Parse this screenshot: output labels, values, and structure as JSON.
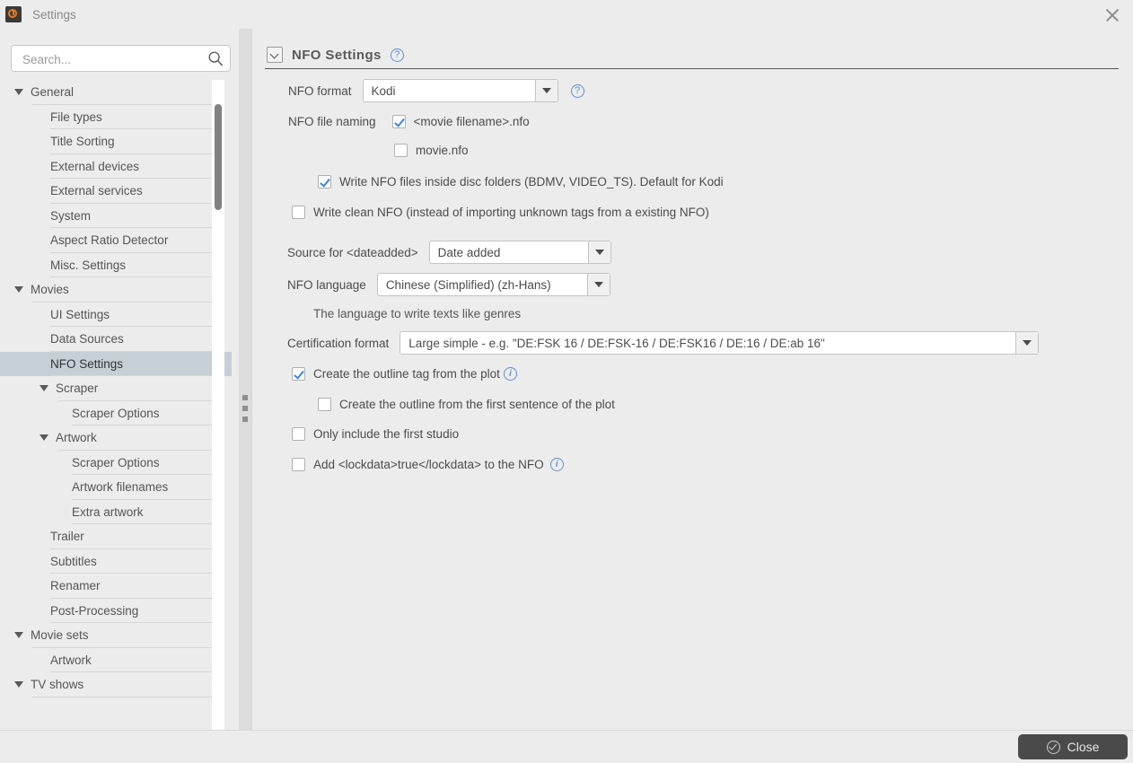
{
  "window": {
    "title": "Settings",
    "app_icon": "tinymediamanager-logo-icon",
    "close_icon": "close-icon"
  },
  "search": {
    "placeholder": "Search...",
    "value": "",
    "icon": "search-icon"
  },
  "sidebar": {
    "items": [
      {
        "label": "General",
        "level": 0,
        "expandable": true,
        "selected": false
      },
      {
        "label": "File types",
        "level": 1,
        "expandable": false,
        "selected": false
      },
      {
        "label": "Title Sorting",
        "level": 1,
        "expandable": false,
        "selected": false
      },
      {
        "label": "External devices",
        "level": 1,
        "expandable": false,
        "selected": false
      },
      {
        "label": "External services",
        "level": 1,
        "expandable": false,
        "selected": false
      },
      {
        "label": "System",
        "level": 1,
        "expandable": false,
        "selected": false
      },
      {
        "label": "Aspect Ratio Detector",
        "level": 1,
        "expandable": false,
        "selected": false
      },
      {
        "label": "Misc. Settings",
        "level": 1,
        "expandable": false,
        "selected": false
      },
      {
        "label": "Movies",
        "level": 0,
        "expandable": true,
        "selected": false
      },
      {
        "label": "UI Settings",
        "level": 1,
        "expandable": false,
        "selected": false
      },
      {
        "label": "Data Sources",
        "level": 1,
        "expandable": false,
        "selected": false
      },
      {
        "label": "NFO Settings",
        "level": 1,
        "expandable": false,
        "selected": true
      },
      {
        "label": "Scraper",
        "level": 2,
        "expandable": true,
        "selected": false
      },
      {
        "label": "Scraper Options",
        "level": 3,
        "expandable": false,
        "selected": false
      },
      {
        "label": "Artwork",
        "level": 2,
        "expandable": true,
        "selected": false
      },
      {
        "label": "Scraper Options",
        "level": 3,
        "expandable": false,
        "selected": false
      },
      {
        "label": "Artwork filenames",
        "level": 3,
        "expandable": false,
        "selected": false
      },
      {
        "label": "Extra artwork",
        "level": 3,
        "expandable": false,
        "selected": false
      },
      {
        "label": "Trailer",
        "level": 1,
        "expandable": false,
        "selected": false
      },
      {
        "label": "Subtitles",
        "level": 1,
        "expandable": false,
        "selected": false
      },
      {
        "label": "Renamer",
        "level": 1,
        "expandable": false,
        "selected": false
      },
      {
        "label": "Post-Processing",
        "level": 1,
        "expandable": false,
        "selected": false
      },
      {
        "label": "Movie sets",
        "level": 0,
        "expandable": true,
        "selected": false
      },
      {
        "label": "Artwork",
        "level": 1,
        "expandable": false,
        "selected": false
      },
      {
        "label": "TV shows",
        "level": 0,
        "expandable": true,
        "selected": false
      }
    ]
  },
  "panel": {
    "title": "NFO Settings",
    "collapse_icon": "chevron-down-box-icon",
    "help_icon": "help-icon",
    "nfo_format": {
      "label": "NFO format",
      "value": "Kodi",
      "help_icon": "help-icon"
    },
    "nfo_file_naming": {
      "label": "NFO file naming",
      "option_movie_filename": "<movie filename>.nfo",
      "option_movie_filename_checked": true,
      "option_movie_nfo": "movie.nfo",
      "option_movie_nfo_checked": false
    },
    "write_disc_folders": {
      "label": "Write NFO files inside disc folders (BDMV, VIDEO_TS). Default for Kodi",
      "checked": true
    },
    "write_clean_nfo": {
      "label": "Write clean NFO (instead of importing unknown tags from a existing NFO)",
      "checked": false
    },
    "dateadded": {
      "label": "Source for <dateadded>",
      "value": "Date added"
    },
    "nfo_language": {
      "label": "NFO language",
      "value": "Chinese (Simplified) (zh-Hans)",
      "hint": "The language to write texts like genres"
    },
    "certification_format": {
      "label": "Certification format",
      "value": "Large simple - e.g. \"DE:FSK 16 / DE:FSK-16 / DE:FSK16 / DE:16 / DE:ab 16\""
    },
    "outline_from_plot": {
      "label": "Create the outline tag from the plot",
      "checked": true,
      "info_icon": "info-icon"
    },
    "outline_first_sentence": {
      "label": "Create the outline from the first sentence of the plot",
      "checked": false
    },
    "only_first_studio": {
      "label": "Only include the first studio",
      "checked": false
    },
    "add_lockdata": {
      "label": "Add <lockdata>true</lockdata> to the NFO",
      "checked": false,
      "info_icon": "info-icon"
    }
  },
  "footer": {
    "close_label": "Close",
    "close_icon": "check-circle-icon"
  },
  "colors": {
    "background": "#ececec",
    "selection": "#c5cfd6",
    "accent_blue": "#5f8fd0",
    "check_blue": "#3d85d8",
    "button_dark": "#4a4a4a",
    "logo_orange": "#ea7a1d"
  }
}
